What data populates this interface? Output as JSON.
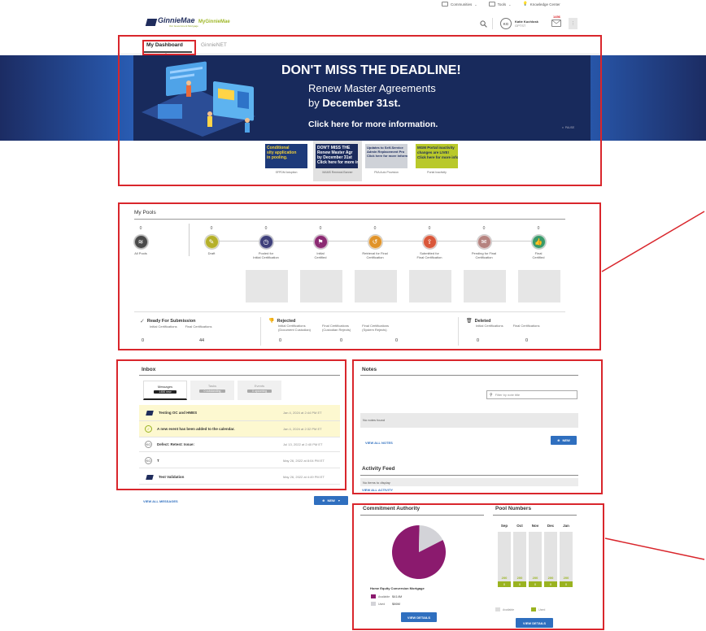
{
  "top_links": {
    "communities": "Communities",
    "tools": "Tools",
    "knowledge_center": "Knowledge Center"
  },
  "header": {
    "logo_text": "GinnieMae",
    "logo_tagline": "Our Government Mortgage",
    "portal_name": "MyGinnieMae",
    "user_initials": "KG",
    "user_name": "Katie Kuchlosk",
    "user_sub": "GPTST",
    "notification_count": "1456"
  },
  "tabs": {
    "dashboard": "My Dashboard",
    "ginnienet": "GinnieNET"
  },
  "banner": {
    "headline": "DON'T MISS THE DEADLINE!",
    "line1": "Renew Master Agreements",
    "line2_prefix": "by ",
    "line2_bold": "December 31st.",
    "cta": "Click here for more information.",
    "pause": "PAUSE"
  },
  "carousel": [
    {
      "caption": "SFPDM Adoption",
      "text": "Conditional\nsity application\nin pooling."
    },
    {
      "caption": "MAMS Renewal Banner",
      "text": "DON'T MISS THE\nRenew Master Agr\nby December 31st\nClick here for more info"
    },
    {
      "caption": "PIIA Auto Provision",
      "text": "Updates to Self-Service\nAdmin Replacement Pro\nClick here for more inform"
    },
    {
      "caption": "Portal Inactivity",
      "text": "MGM Portal inactivity\nchanges are LIVE!\nClick here for more inform"
    }
  ],
  "my_pools": {
    "title": "My Pools",
    "stages": [
      {
        "count": "0",
        "label": "All Pools",
        "color": "#4a4a4a",
        "icon": "layers-icon"
      },
      {
        "count": "0",
        "label": "Draft",
        "color": "#b5b02a",
        "icon": "pencil-icon"
      },
      {
        "count": "0",
        "label": "Pooled for\nInitial Certification",
        "color": "#3e3f7a",
        "icon": "clock-icon"
      },
      {
        "count": "0",
        "label": "Initial\nCertified",
        "color": "#8b2a72",
        "icon": "flag-icon"
      },
      {
        "count": "0",
        "label": "Retrieval for Final\nCertification",
        "color": "#e0932a",
        "icon": "retrieve-icon"
      },
      {
        "count": "0",
        "label": "Submitted for\nFinal Certification",
        "color": "#d9573a",
        "icon": "submit-icon"
      },
      {
        "count": "0",
        "label": "Pending for Final\nCertification",
        "color": "#b5837f",
        "icon": "envelope-icon"
      },
      {
        "count": "0",
        "label": "Final\nCertified",
        "color": "#3a9a6a",
        "icon": "thumbs-up-icon"
      }
    ],
    "ready": {
      "title": "Ready For Submission",
      "col1": "Initial Certifications",
      "col2": "Final Certifications",
      "val1": "0",
      "val2": "44"
    },
    "rejected": {
      "title": "Rejected",
      "col1": "Initial Certifications\n(Document Custodian)",
      "col2": "Final Certifications\n(Custodian Rejects)",
      "col3": "Final Certifications\n(System Rejects)",
      "val1": "0",
      "val2": "0",
      "val3": "0"
    },
    "deleted": {
      "title": "Deleted",
      "col1": "Initial Certifications",
      "col2": "Final Certifications",
      "val1": "0",
      "val2": "0"
    }
  },
  "inbox": {
    "title": "Inbox",
    "tabs": [
      {
        "label": "Messages",
        "badge": "1456 new"
      },
      {
        "label": "Tasks",
        "badge": "0 outstanding"
      },
      {
        "label": "Events",
        "badge": "0 upcoming"
      }
    ],
    "rows": [
      {
        "title": "Testing OC and HMES",
        "date": "Jan 4, 2024 at 2:44 PM ET"
      },
      {
        "title": "A new event has been added to the calendar.",
        "date": "Jan 4, 2024 at 2:32 PM ET"
      },
      {
        "title": "Defect: Retest: Issue:",
        "date": "Jul 13, 2022 at 2:40 PM ET",
        "initials": "KG"
      },
      {
        "title": "T",
        "date": "May 26, 2022 at 8:04 PM ET",
        "initials": "KG"
      },
      {
        "title": "Test Validation",
        "date": "May 26, 2022 at 4:49 PM ET"
      }
    ],
    "view_all": "VIEW ALL MESSAGES",
    "new_button": "NEW"
  },
  "notes": {
    "title": "Notes",
    "filter_placeholder": "Filter by note title",
    "empty": "No notes found",
    "view_all": "VIEW ALL NOTES",
    "new_button": "NEW"
  },
  "activity": {
    "title": "Activity Feed",
    "empty": "No items to display",
    "view_all": "VIEW ALL ACTIVITY"
  },
  "commitment": {
    "title": "Commitment Authority",
    "product": "Home Equity Conversion Mortgage",
    "available_label": "Available",
    "available_value": "$414M",
    "used_label": "Used",
    "used_value": "$86M",
    "view_details": "VIEW DETAILS",
    "colors": {
      "available": "#8b1a6e",
      "used": "#d3d3d8"
    },
    "chart_data": {
      "type": "pie",
      "title": "",
      "labels": [
        "Available",
        "Used"
      ],
      "values": [
        414,
        86
      ]
    }
  },
  "pool_numbers": {
    "title": "Pool Numbers",
    "months": [
      "Sep",
      "Oct",
      "Nov",
      "Dec",
      "Jan"
    ],
    "available": [
      "200",
      "200",
      "200",
      "200",
      "200"
    ],
    "used": [
      "0",
      "0",
      "0",
      "0",
      "0"
    ],
    "legend_available": "Available",
    "legend_used": "Used",
    "view_details": "VIEW DETAILS"
  }
}
